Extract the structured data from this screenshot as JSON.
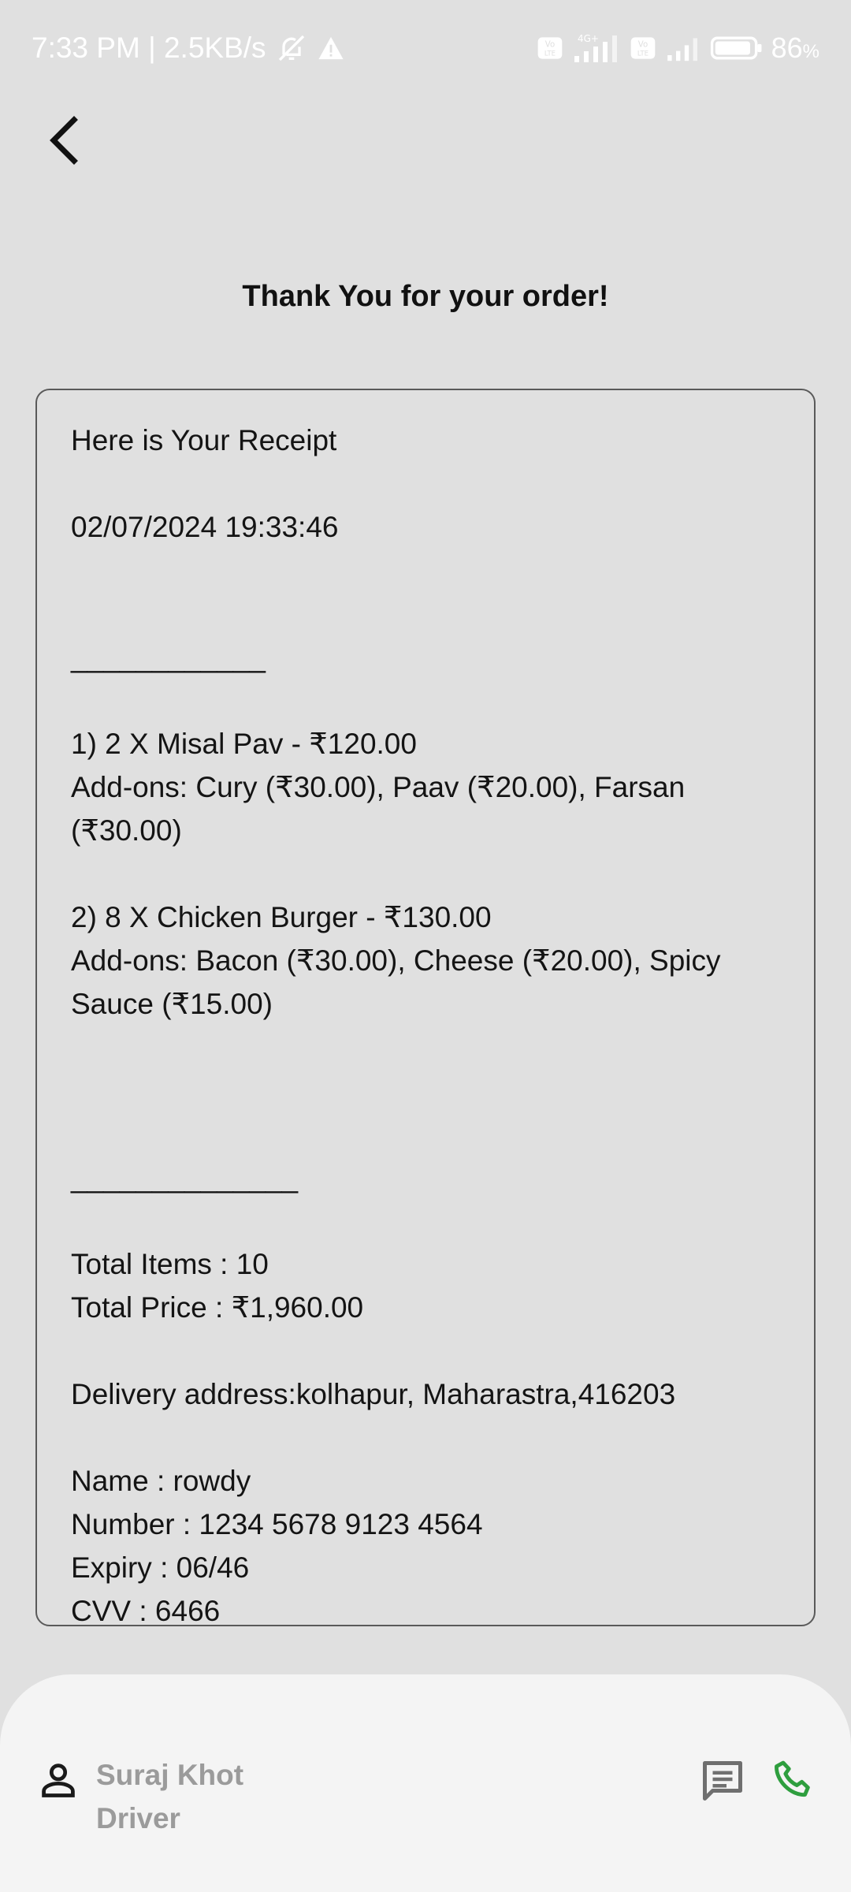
{
  "status_bar": {
    "time_speed": "7:33 PM | 2.5KB/s",
    "network_type": "4G+",
    "volte_label": "Vo LTE",
    "battery_percent": "86",
    "battery_unit": "%",
    "icons": [
      "muted-bell-icon",
      "warning-icon",
      "volte-icon",
      "signal-icon",
      "battery-icon"
    ]
  },
  "header": {
    "back_icon": "chevron-left-icon",
    "title": "Thank You for your order!"
  },
  "receipt": {
    "heading": "Here is Your Receipt",
    "datetime": "02/07/2024 19:33:46",
    "divider_top": "____________",
    "items": [
      {
        "line": "1) 2 X Misal Pav - ₹120.00",
        "addons": "Add-ons: Cury (₹30.00), Paav (₹20.00), Farsan (₹30.00)"
      },
      {
        "line": "2) 8 X Chicken Burger - ₹130.00",
        "addons": "Add-ons: Bacon (₹30.00), Cheese (₹20.00), Spicy Sauce (₹15.00)"
      }
    ],
    "divider_bottom": "______________",
    "total_items": "Total Items : 10",
    "total_price": "Total Price : ₹1,960.00",
    "delivery_address": "Delivery address:kolhapur, Maharastra,416203",
    "card_name": "Name : rowdy",
    "card_number": "Number : 1234 5678 9123 4564",
    "card_expiry": "Expiry : 06/46",
    "card_cvv": "CVV : 6466"
  },
  "driver": {
    "name": "Suraj Khot",
    "role": "Driver",
    "avatar_icon": "person-icon",
    "message_icon": "message-icon",
    "call_icon": "phone-icon",
    "call_color": "#2e9e3e"
  }
}
